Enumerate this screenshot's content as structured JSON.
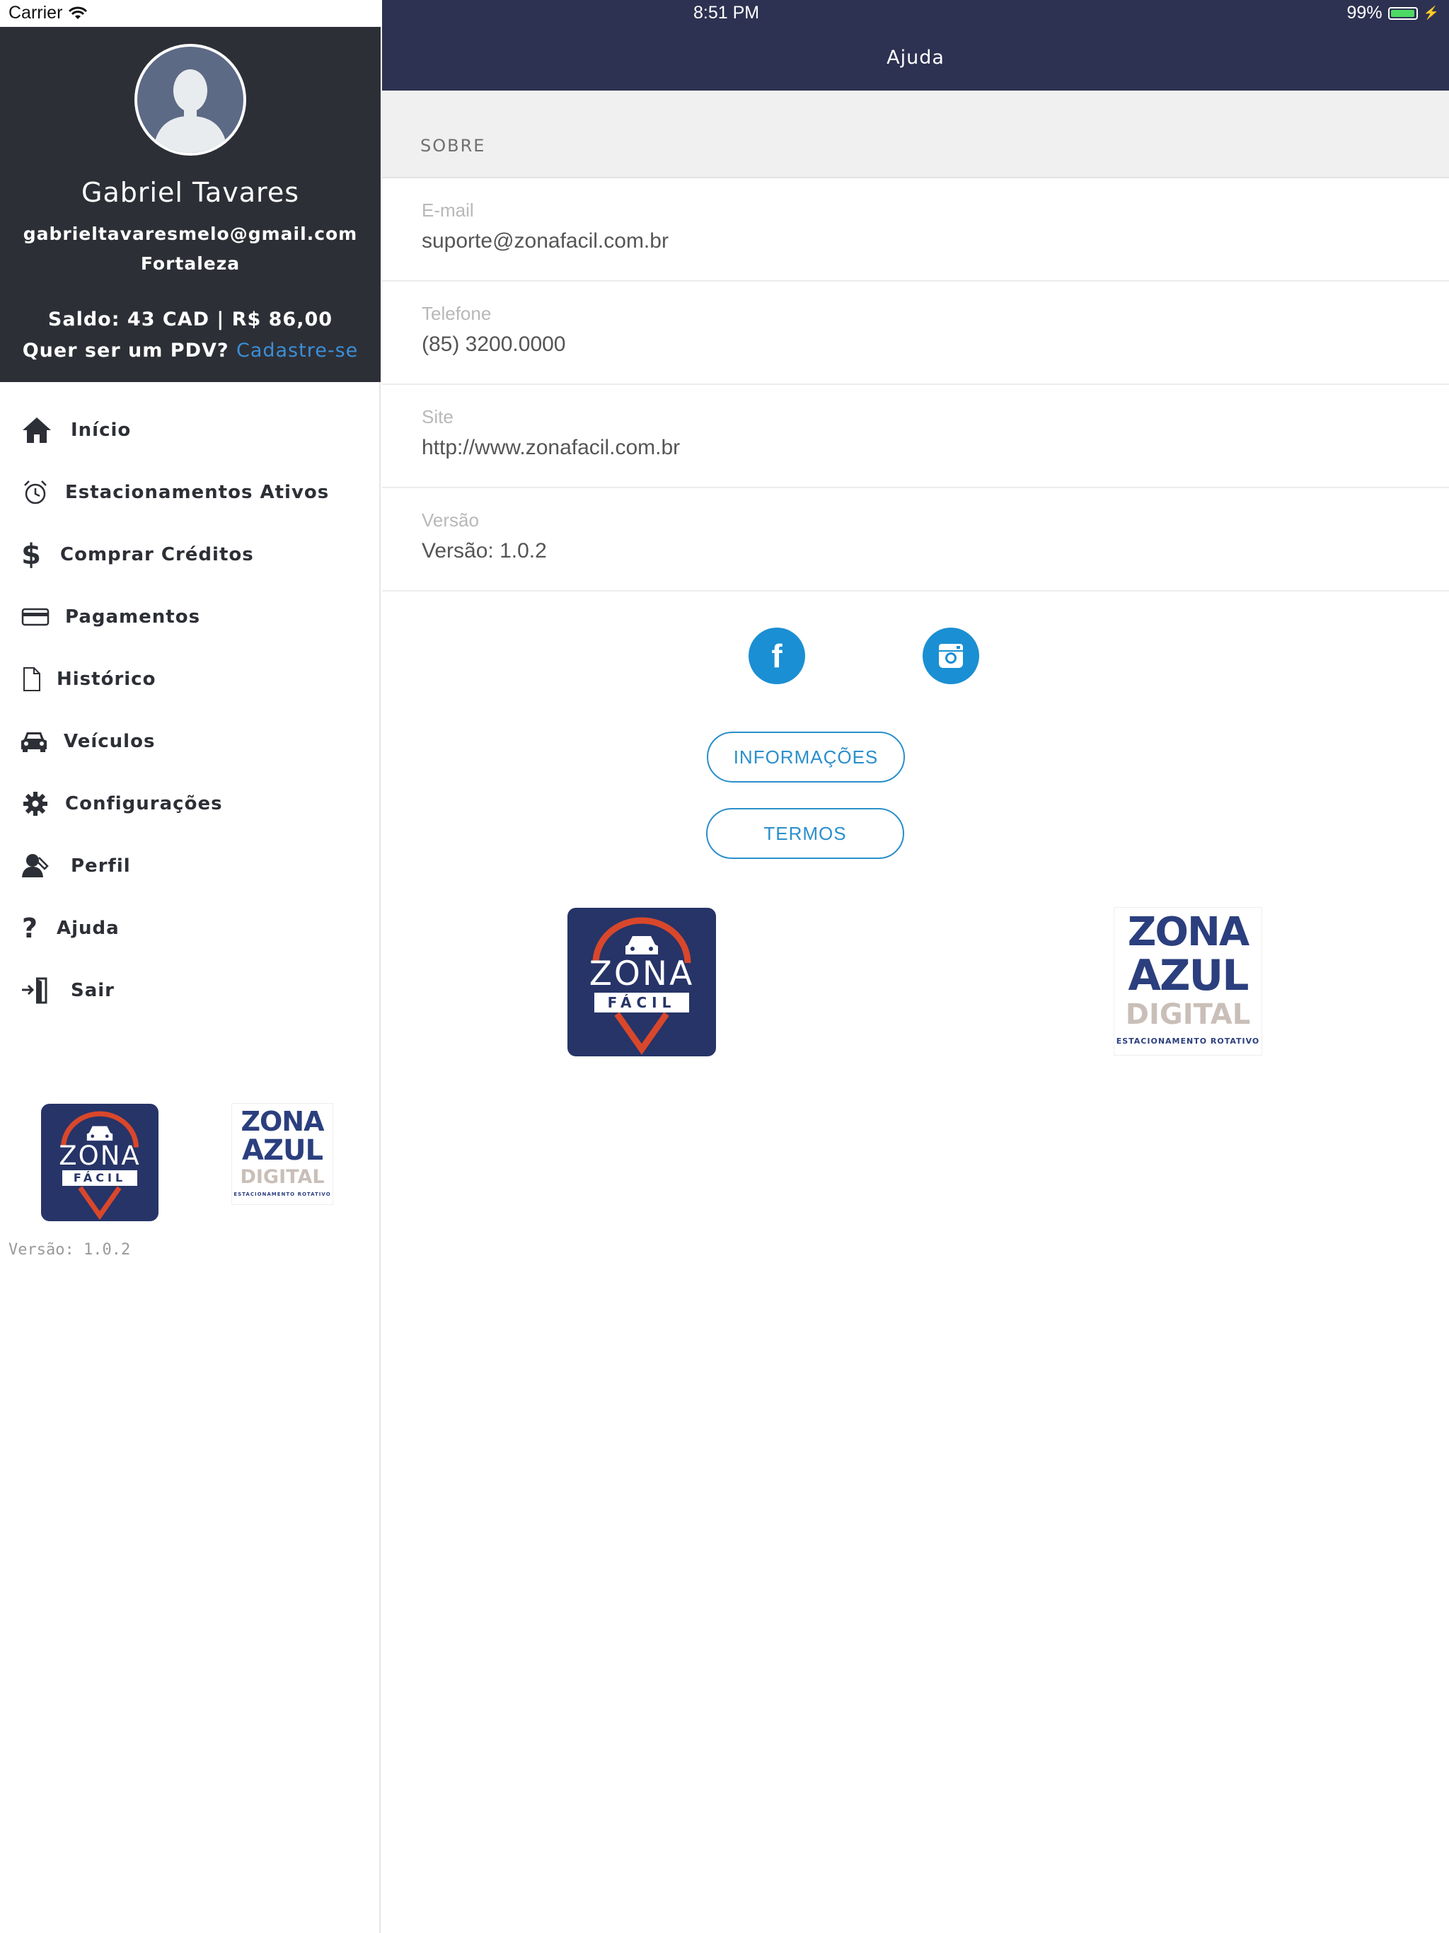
{
  "status_bar": {
    "carrier": "Carrier",
    "time": "8:51 PM",
    "battery": "99%"
  },
  "sidebar": {
    "user": {
      "name": "Gabriel Tavares",
      "email": "gabrieltavaresmelo@gmail.com",
      "city": "Fortaleza",
      "balance": "Saldo: 43 CAD | R$ 86,00",
      "pdv_question": "Quer ser um PDV?",
      "pdv_link": "Cadastre-se"
    },
    "menu": [
      {
        "label": "Início",
        "icon": "home-icon"
      },
      {
        "label": "Estacionamentos Ativos",
        "icon": "alarm-clock-icon"
      },
      {
        "label": "Comprar Créditos",
        "icon": "dollar-icon"
      },
      {
        "label": "Pagamentos",
        "icon": "credit-card-icon"
      },
      {
        "label": "Histórico",
        "icon": "document-icon"
      },
      {
        "label": "Veículos",
        "icon": "car-icon"
      },
      {
        "label": "Configurações",
        "icon": "gear-icon"
      },
      {
        "label": "Perfil",
        "icon": "user-edit-icon"
      },
      {
        "label": "Ajuda",
        "icon": "question-icon"
      },
      {
        "label": "Sair",
        "icon": "exit-door-icon"
      }
    ],
    "version": "Versão: 1.0.2"
  },
  "logos": {
    "zona_facil": {
      "word": "ZONA",
      "sub": "FÁCIL"
    },
    "zona_azul": {
      "line1": "ZONA",
      "line2": "AZUL",
      "line3": "DIGITAL",
      "tagline": "ESTACIONAMENTO ROTATIVO"
    }
  },
  "main": {
    "title": "Ajuda",
    "section": "SOBRE",
    "rows": [
      {
        "label": "E-mail",
        "value": "suporte@zonafacil.com.br"
      },
      {
        "label": "Telefone",
        "value": "(85) 3200.0000"
      },
      {
        "label": "Site",
        "value": "http://www.zonafacil.com.br"
      },
      {
        "label": "Versão",
        "value": "Versão: 1.0.2"
      }
    ],
    "buttons": {
      "info": "INFORMAÇÕES",
      "terms": "TERMOS"
    }
  },
  "colors": {
    "sidebar_header": "#2d2f36",
    "navbar": "#2d3252",
    "accent_blue": "#1a8fd3",
    "zona_facil_bg": "#263468",
    "zona_facil_red": "#d9472b",
    "zona_azul_blue": "#2b3f7e",
    "zona_azul_grey": "#c9bfb8"
  }
}
